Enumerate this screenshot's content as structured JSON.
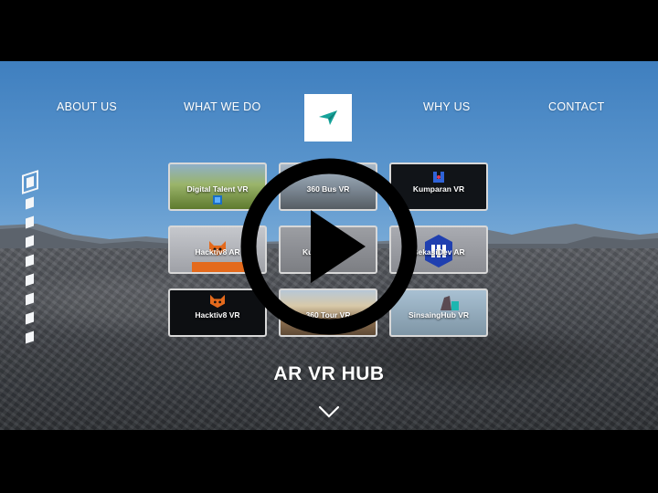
{
  "nav": {
    "items": [
      "ABOUT US",
      "WHAT WE DO",
      "WHY US",
      "CONTACT"
    ]
  },
  "logo": {
    "icon": "paper-plane-logo",
    "color": "#16a39a"
  },
  "side_nav": {
    "count": 9,
    "active_index": 0
  },
  "cards": [
    {
      "label": "Digital Talent VR",
      "theme": "#6e8a3a"
    },
    {
      "label": "360 Bus VR",
      "theme": "#7a8a99"
    },
    {
      "label": "Kumparan VR",
      "theme": "#111418"
    },
    {
      "label": "Hacktiv8 AR",
      "theme": "#a8aab0"
    },
    {
      "label": "Ku",
      "theme": "#8d8f94"
    },
    {
      "label": "BekasiDev AR",
      "theme": "#9a9ca2"
    },
    {
      "label": "Hacktiv8 VR",
      "theme": "#0d0f12"
    },
    {
      "label": "360 Tour VR",
      "theme": "#8a7560"
    },
    {
      "label": "SinsaingHub VR",
      "theme": "#8ea4b4"
    }
  ],
  "title": "AR VR HUB",
  "icons": {
    "scroll": "chevron-down-icon",
    "play": "play-icon"
  }
}
